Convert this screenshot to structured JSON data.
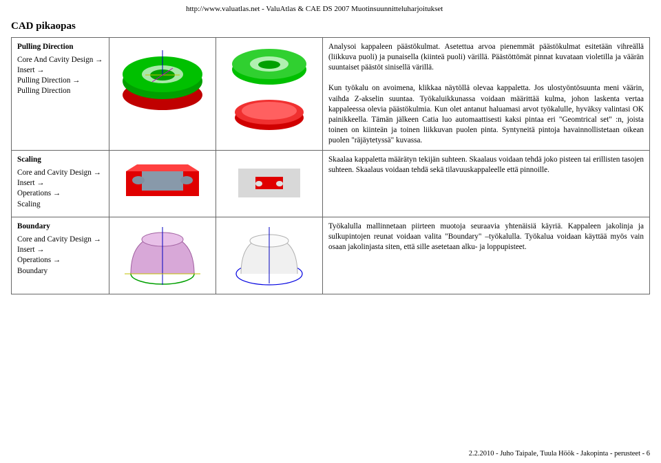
{
  "header_url": "http://www.valuatlas.net - ValuAtlas & CAE DS 2007 Muotinsuunnitteluharjoitukset",
  "page_title": "CAD pikaopas",
  "rows": [
    {
      "left_title": "Pulling Direction",
      "left_sub": "Core And Cavity Design",
      "left_path": [
        "Insert",
        "Pulling Direction",
        "Pulling Direction"
      ],
      "right": "Analysoi kappaleen päästökulmat. Asetettua arvoa pienemmät päästökulmat esitetään vihreällä (liikkuva puoli) ja punaisella (kiinteä puoli) värillä. Päästöttömät pinnat kuvataan violetilla ja väärän suuntaiset päästöt sinisellä värillä.",
      "right2": "Kun työkalu on avoimena, klikkaa näytöllä olevaa kappaletta. Jos ulostyöntösuunta meni väärin, vaihda Z-akselin suuntaa. Työkaluikkunassa voidaan määrittää kulma, johon laskenta vertaa kappaleessa olevia päästökulmia. Kun olet antanut haluamasi arvot työkalulle, hyväksy valintasi OK painikkeella. Tämän jälkeen Catia luo automaattisesti kaksi pintaa eri \"Geomtrical set\" :n, joista toinen on kiinteän ja toinen liikkuvan puolen pinta. Syntyneitä pintoja havainnollistetaan oikean puolen \"räjäytetyssä\" kuvassa."
    },
    {
      "left_title": "Scaling",
      "left_sub": "Core and Cavity Design",
      "left_path": [
        "Insert",
        "Operations",
        "Scaling"
      ],
      "right": "Skaalaa kappaletta määrätyn tekijän suhteen. Skaalaus voidaan tehdä joko pisteen tai erillisten tasojen suhteen. Skaalaus voidaan tehdä sekä tilavuuskappaleelle että pinnoille."
    },
    {
      "left_title": "Boundary",
      "left_sub": "Core and Cavity Design",
      "left_path": [
        "Insert",
        "Operations",
        "Boundary"
      ],
      "right": "Työkalulla mallinnetaan piirteen muotoja seuraavia yhtenäisiä käyriä. Kappaleen jakolinja ja sulkupintojen reunat voidaan valita \"Boundary\" –työkalulla. Työkalua voidaan käyttää myös vain osaan jakolinjasta siten, että sille asetetaan alku- ja loppupisteet."
    }
  ],
  "footer": "2.2.2010 - Juho Taipale, Tuula Höök - Jakopinta - perusteet - 6"
}
